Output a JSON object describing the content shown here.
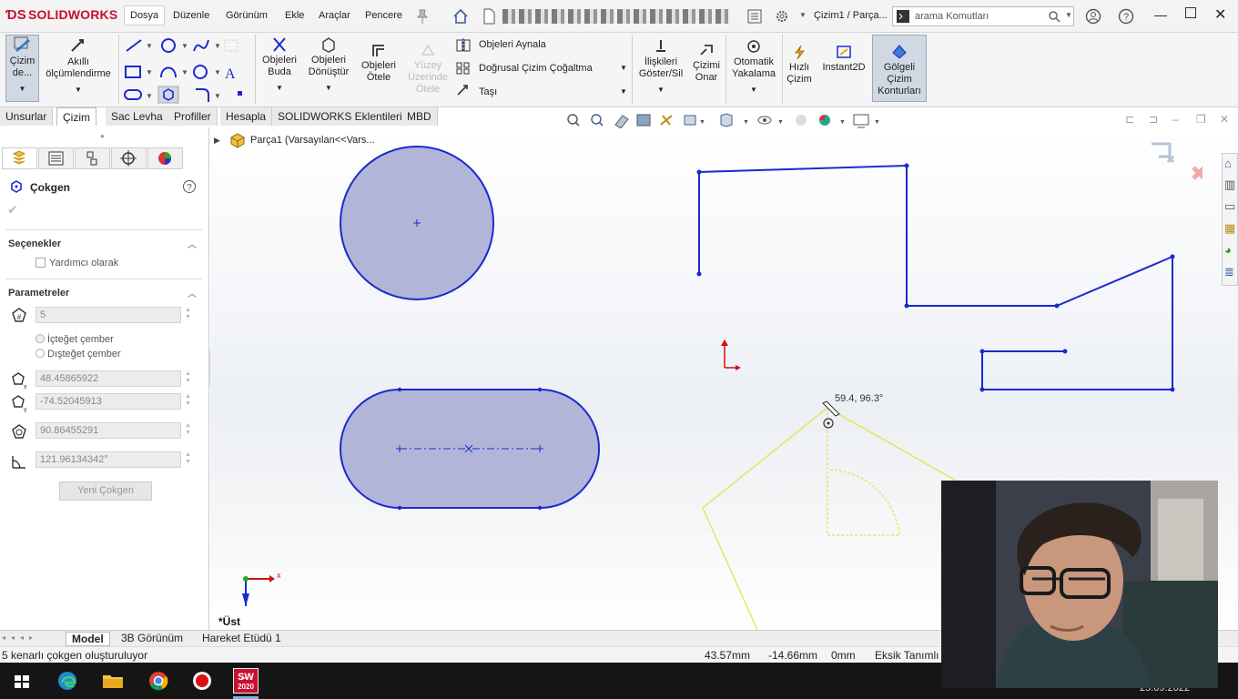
{
  "app": {
    "brand": "SOLIDWORKS",
    "doc_title": "Çizim1 / Parça...",
    "search_placeholder": "arama Komutları",
    "menu": [
      "Dosya",
      "Düzenle",
      "Görünüm",
      "Ekle",
      "Araçlar",
      "Pencere"
    ]
  },
  "commands": {
    "sketch": "Çizim de...",
    "smart_dim": "Akıllı ölçümlendirme",
    "trim": "Objeleri Buda",
    "convert": "Objeleri Dönüştür",
    "offset": "Objeleri Ötele",
    "surface_offset": "Yüzey Üzerinde Ötele",
    "mirror": "Objeleri Aynala",
    "linear_pattern": "Doğrusal Çizim Çoğaltma",
    "move": "Taşı",
    "relations": "İlişkileri Göster/Sil",
    "repair": "Çizimi Onar",
    "quick_snaps": "Otomatik Yakalama",
    "rapid_sketch": "Hızlı Çizim",
    "instant2d": "Instant2D",
    "shaded": "Gölgeli Çizim Konturları"
  },
  "tabs": [
    "Unsurlar",
    "Çizim",
    "Sac Levha",
    "Profiller",
    "Hesapla",
    "SOLIDWORKS Eklentileri",
    "MBD"
  ],
  "tabs_active": "Çizim",
  "tree_label": "Parça1  (Varsayılan<<Vars...",
  "panel": {
    "title": "Çokgen",
    "options_title": "Seçenekler",
    "construction_label": "Yardımcı olarak",
    "params_title": "Parametreler",
    "sides": "5",
    "inscribed": "İçteğet çember",
    "circumscribed": "Dışteğet çember",
    "center_x": "48.45865922",
    "center_y": "-74.52045913",
    "diameter": "90.86455291",
    "angle": "121.96134342°",
    "new_polygon": "Yeni Çokgen"
  },
  "graphics": {
    "cursor_readout": "59.4, 96.3°",
    "view_label": "*Üst",
    "axis_x": "x"
  },
  "bottom_tabs": [
    "Model",
    "3B Görünüm",
    "Hareket Etüdü 1"
  ],
  "status": {
    "message": "5 kenarlı çokgen oluşturuluyor",
    "x": "43.57mm",
    "y": "-14.66mm",
    "z": "0mm",
    "state": "Eksik Tanımlı"
  },
  "taskbar": {
    "date": "25.09.2022",
    "sw_badge": "2020"
  },
  "colors": {
    "sketch_blue": "#1a2bcc",
    "fill": "#b1b6d8",
    "preview_yellow": "#e6e24a",
    "brand_red": "#c8102e"
  }
}
